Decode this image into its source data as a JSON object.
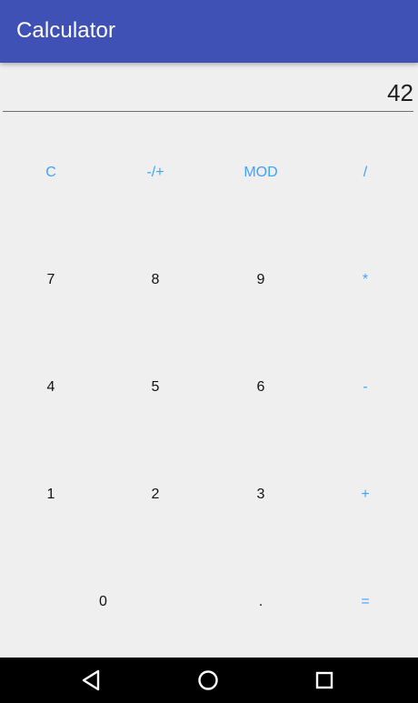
{
  "app": {
    "title": "Calculator"
  },
  "display": {
    "value": "42"
  },
  "keypad": {
    "clear": "C",
    "sign": "-/+",
    "mod": "MOD",
    "divide": "/",
    "seven": "7",
    "eight": "8",
    "nine": "9",
    "multiply": "*",
    "four": "4",
    "five": "5",
    "six": "6",
    "subtract": "-",
    "one": "1",
    "two": "2",
    "three": "3",
    "add": "+",
    "zero": "0",
    "decimal": ".",
    "equals": "="
  },
  "navigation": {
    "back_icon": "back-icon",
    "home_icon": "home-icon",
    "recent_icon": "recent-apps-icon"
  },
  "colors": {
    "app_bar": "#3f51b5",
    "background": "#efefef",
    "operator": "#3da2ff",
    "number": "#111111",
    "navigation_bar": "#000000"
  }
}
